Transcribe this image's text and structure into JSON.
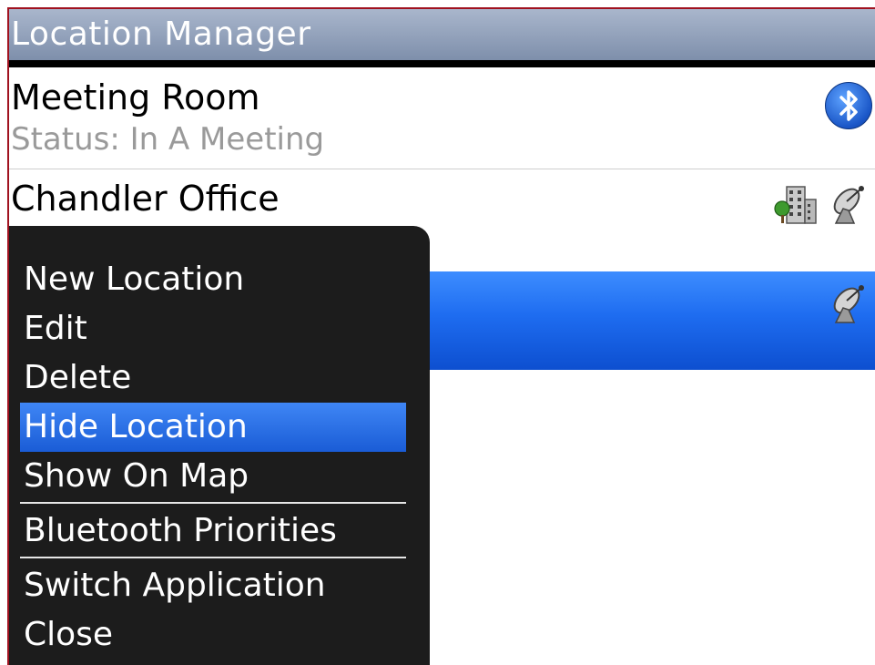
{
  "app": {
    "title": "Location Manager"
  },
  "locations": [
    {
      "name": "Meeting Room",
      "status": "Status: In A Meeting",
      "icons": [
        "bluetooth-icon"
      ]
    },
    {
      "name": "Chandler Office",
      "status": "",
      "icons": [
        "building-icon",
        "satellite-icon"
      ]
    },
    {
      "name": "",
      "status": "",
      "icons": [
        "satellite-icon"
      ],
      "selected": true
    }
  ],
  "menu": {
    "items": [
      {
        "label": "New Location"
      },
      {
        "label": "Edit"
      },
      {
        "label": "Delete"
      },
      {
        "label": "Hide Location",
        "selected": true
      },
      {
        "label": "Show On Map"
      },
      {
        "label": "Bluetooth Priorities"
      },
      {
        "label": "Switch Application"
      },
      {
        "label": "Close"
      }
    ]
  },
  "colors": {
    "titlebar": "#8c9bb4",
    "selection_blue": "#1e6cf0",
    "menu_background": "#1c1c1c",
    "status_gray": "#9a9a9a"
  }
}
